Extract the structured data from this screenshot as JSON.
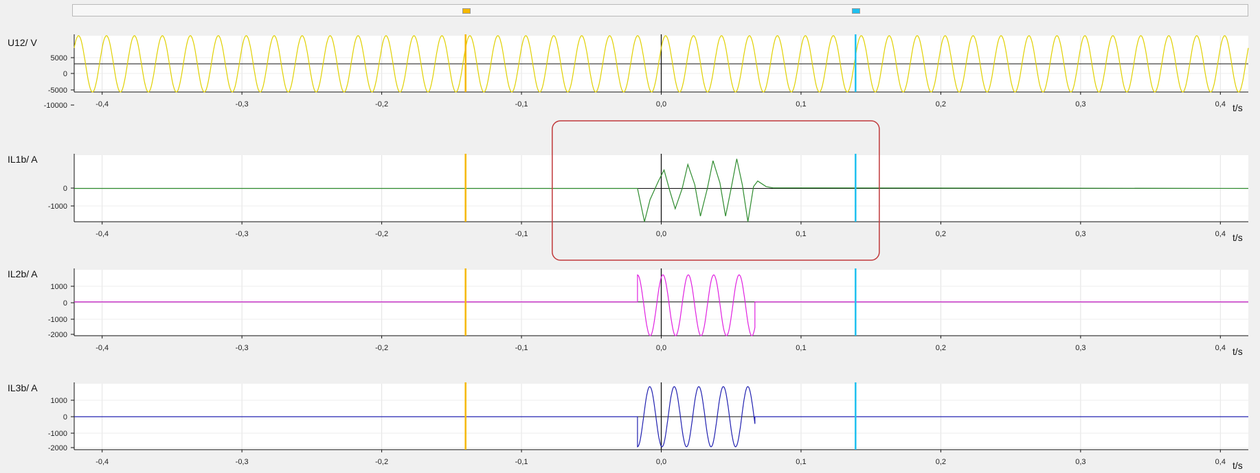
{
  "cursors": {
    "left_color": "#f5b800",
    "right_color": "#1ec0ef",
    "left_t": -0.14,
    "right_t": 0.139
  },
  "highlight": {
    "color": "#c0393b",
    "t_from": -0.078,
    "t_to": 0.156
  },
  "chart_data": [
    {
      "type": "line",
      "ylabel": "U12/ V",
      "xlabel": "t/s",
      "xlim": [
        -0.42,
        0.42
      ],
      "ylim": [
        -10000,
        10000
      ],
      "xticks": [
        "-0,4",
        "-0,3",
        "-0,2",
        "-0,1",
        "0,0",
        "0,1",
        "0,2",
        "0,3",
        "0,4"
      ],
      "yticks": [
        "5000",
        "0",
        "-5000",
        "-10000"
      ],
      "series": [
        {
          "color": "#e0d000",
          "waveform": "sine",
          "frequency_hz": 50,
          "amplitude": 10000,
          "t_start": -0.42,
          "t_end": 0.42
        }
      ]
    },
    {
      "type": "line",
      "ylabel": "IL1b/ A",
      "xlabel": "t/s",
      "xlim": [
        -0.42,
        0.42
      ],
      "ylim": [
        -1800,
        1800
      ],
      "xticks": [
        "-0,4",
        "-0,3",
        "-0,2",
        "-0,1",
        "0,0",
        "0,1",
        "0,2",
        "0,3",
        "0,4"
      ],
      "yticks": [
        "0",
        "-1000"
      ],
      "series": [
        {
          "color": "#2e8b2e",
          "waveform": "fault_burst",
          "points": [
            [
              -0.017,
              0
            ],
            [
              -0.012,
              -1800
            ],
            [
              -0.008,
              -600
            ],
            [
              -0.002,
              400
            ],
            [
              0.002,
              1000
            ],
            [
              0.006,
              -100
            ],
            [
              0.01,
              -1100
            ],
            [
              0.015,
              0
            ],
            [
              0.019,
              1300
            ],
            [
              0.024,
              200
            ],
            [
              0.028,
              -1500
            ],
            [
              0.033,
              0
            ],
            [
              0.037,
              1500
            ],
            [
              0.042,
              300
            ],
            [
              0.046,
              -1500
            ],
            [
              0.05,
              0
            ],
            [
              0.054,
              1600
            ],
            [
              0.058,
              200
            ],
            [
              0.062,
              -1800
            ],
            [
              0.066,
              100
            ],
            [
              0.069,
              400
            ],
            [
              0.075,
              100
            ],
            [
              0.08,
              30
            ],
            [
              0.113,
              30
            ]
          ]
        }
      ]
    },
    {
      "type": "line",
      "ylabel": "IL2b/ A",
      "xlabel": "t/s",
      "xlim": [
        -0.42,
        0.42
      ],
      "ylim": [
        -2000,
        1900
      ],
      "xticks": [
        "-0,4",
        "-0,3",
        "-0,2",
        "-0,1",
        "0,0",
        "0,1",
        "0,2",
        "0,3",
        "0,4"
      ],
      "yticks": [
        "1000",
        "0",
        "-1000",
        "-2000"
      ],
      "series": [
        {
          "color": "#e020e0",
          "waveform": "burst_sine",
          "frequency_hz": 55,
          "amplitude": 1800,
          "offset": -200,
          "t_start": -0.017,
          "t_end": 0.067
        }
      ]
    },
    {
      "type": "line",
      "ylabel": "IL3b/ A",
      "xlabel": "t/s",
      "xlim": [
        -0.42,
        0.42
      ],
      "ylim": [
        -2300,
        2300
      ],
      "xticks": [
        "-0,4",
        "-0,3",
        "-0,2",
        "-0,1",
        "0,0",
        "0,1",
        "0,2",
        "0,3",
        "0,4"
      ],
      "yticks": [
        "1000",
        "0",
        "-1000",
        "-2000"
      ],
      "series": [
        {
          "color": "#2020b0",
          "waveform": "burst_sine",
          "frequency_hz": 57,
          "amplitude": 2100,
          "offset": 0,
          "t_start": -0.017,
          "t_end": 0.067
        }
      ]
    }
  ]
}
